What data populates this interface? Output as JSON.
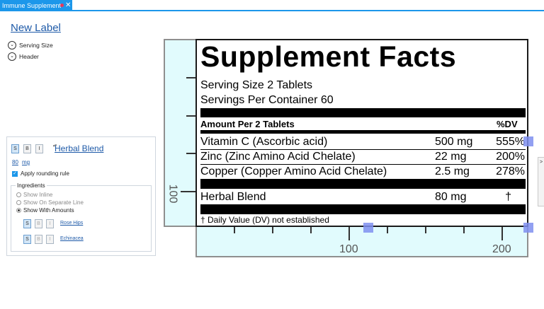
{
  "tab": {
    "title": "Immune Supplement",
    "close": "✕"
  },
  "left": {
    "new_label": "New Label",
    "sections": [
      "Serving Size",
      "Header"
    ],
    "chevron": "⌄"
  },
  "editor": {
    "bold_buttons": {
      "s": "S",
      "b": "B",
      "i": "I"
    },
    "spinner": "▴▾",
    "ingredient_name": "Herbal Blend",
    "amount": "80",
    "unit": "mg",
    "rounding_label": "Apply rounding rule",
    "rounding_checked": true,
    "ingredients_legend": "Ingredients",
    "display_options": [
      "Show Inline",
      "Show On Separate Line",
      "Show With Amounts"
    ],
    "selected_option": "Show With Amounts",
    "sub_ingredients": [
      "Rose Hips",
      "Echinacea"
    ]
  },
  "facts": {
    "title": "Supplement Facts",
    "serving_size": "Serving Size 2 Tablets",
    "servings_per_container": "Servings Per Container 60",
    "amount_header": "Amount Per 2 Tablets",
    "dv_header": "%DV",
    "rows": [
      {
        "name": "Vitamin C (Ascorbic acid)",
        "amount": "500 mg",
        "dv": "555%"
      },
      {
        "name": "Zinc (Zinc Amino Acid Chelate)",
        "amount": "22 mg",
        "dv": "200%"
      },
      {
        "name": "Copper (Copper Amino Acid Chelate)",
        "amount": "2.5 mg",
        "dv": "278%"
      }
    ],
    "blend": {
      "name": "Herbal Blend",
      "amount": "80 mg",
      "dv": "†"
    },
    "footnote": "† Daily Value (DV) not established"
  },
  "ruler": {
    "vertical_label": "100",
    "h_labels": [
      "100",
      "200"
    ]
  },
  "side_tab": ">"
}
